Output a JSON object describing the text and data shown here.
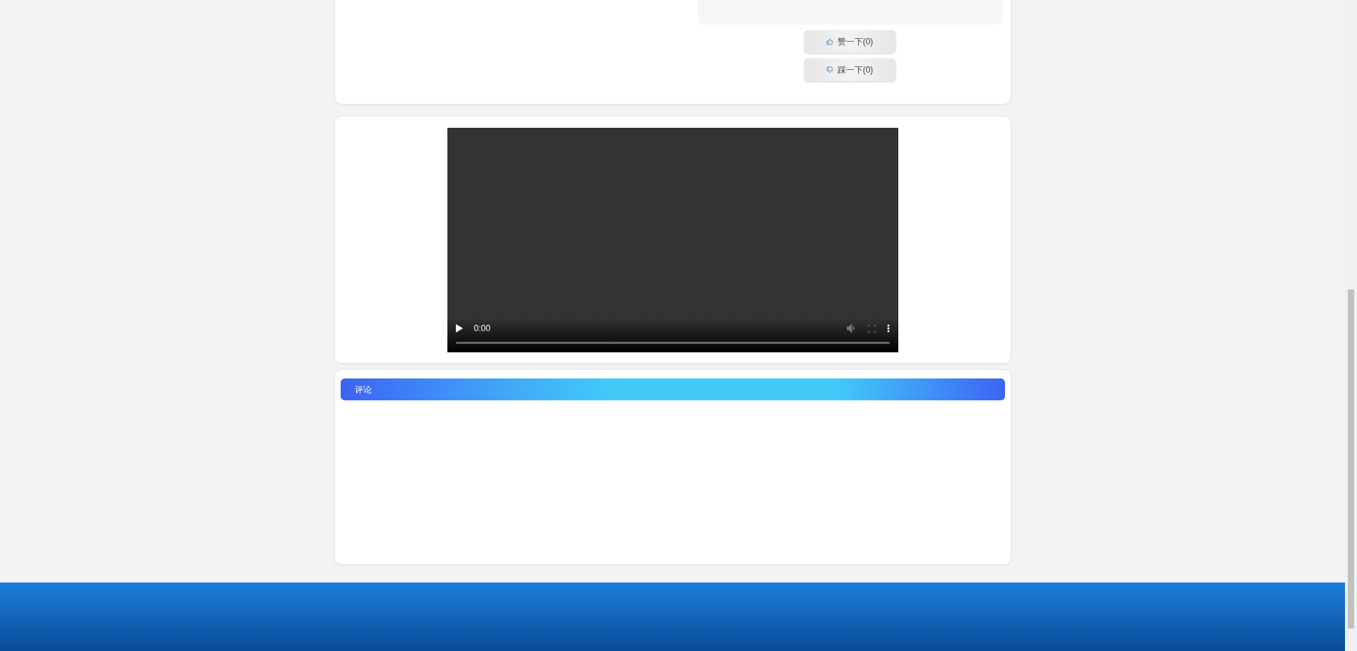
{
  "reactions": [
    {
      "kind": "like",
      "label": "赞一下(0)"
    },
    {
      "kind": "dislike",
      "label": "踩一下(0)"
    }
  ],
  "video": {
    "time": "0:00",
    "level": 0
  },
  "comments": {
    "title": "评论"
  }
}
